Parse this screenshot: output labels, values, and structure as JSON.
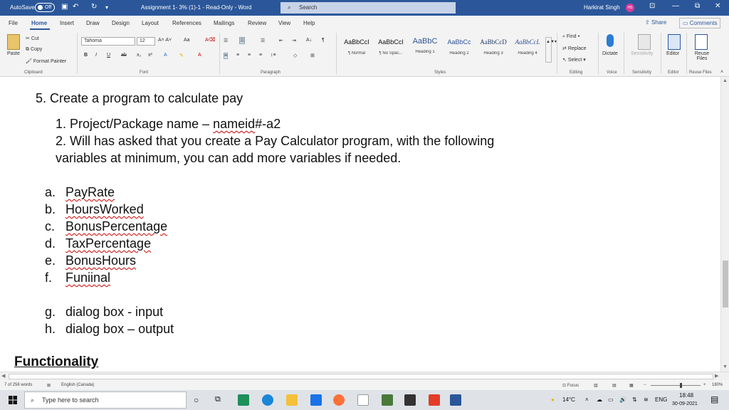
{
  "titlebar": {
    "autosave": "AutoSave",
    "toggle": "Off",
    "doc_title": "Assignment 1- 3% (1)-1 - Read-Only - Word",
    "search": "Search",
    "user": "Harkirat Singh",
    "avatar": "HS"
  },
  "tabs": [
    "File",
    "Home",
    "Insert",
    "Draw",
    "Design",
    "Layout",
    "References",
    "Mailings",
    "Review",
    "View",
    "Help"
  ],
  "share": "Share",
  "comments": "Comments",
  "ribbon": {
    "clipboard": {
      "paste": "Paste",
      "cut": "Cut",
      "copy": "Copy",
      "format_painter": "Format Painter",
      "label": "Clipboard"
    },
    "font": {
      "name": "Tahoma",
      "size": "12",
      "label": "Font"
    },
    "paragraph": {
      "label": "Paragraph"
    },
    "styles": {
      "label": "Styles",
      "items": [
        {
          "sample": "AaBbCcI",
          "name": "¶ Normal"
        },
        {
          "sample": "AaBbCcI",
          "name": "¶ No Spac..."
        },
        {
          "sample": "AaBbC",
          "name": "Heading 1"
        },
        {
          "sample": "AaBbCc",
          "name": "Heading 2"
        },
        {
          "sample": "AaBbCcD",
          "name": "Heading 3"
        },
        {
          "sample": "AaBbCcL",
          "name": "Heading 4"
        }
      ]
    },
    "editing": {
      "find": "Find",
      "replace": "Replace",
      "select": "Select",
      "label": "Editing"
    },
    "voice": {
      "dictate": "Dictate",
      "label": "Voice"
    },
    "sensitivity": {
      "btn": "Sensitivity",
      "label": "Sensitivity"
    },
    "editor": {
      "btn": "Editor",
      "label": "Editor"
    },
    "reuse": {
      "btn": "Reuse Files",
      "label": "Reuse Files"
    }
  },
  "document": {
    "item5": "5.  Create a program to calculate pay",
    "sub1_prefix": "1.  Project/Package name – ",
    "sub1_name": "nameid",
    "sub1_suffix": "#-a2",
    "sub2_line1": "2.  Will has asked that you create a Pay Calculator program, with the following",
    "sub2_line2": "variables at minimum, you can add more variables if needed.",
    "vars": [
      {
        "marker": "a.",
        "name": "PayRate"
      },
      {
        "marker": "b.",
        "name": "HoursWorked"
      },
      {
        "marker": "c.",
        "name": "BonusPercentage"
      },
      {
        "marker": "d.",
        "name": "TaxPercentage"
      },
      {
        "marker": "e.",
        "name": "BonusHours"
      },
      {
        "marker": "f.",
        "name": "Funiinal"
      }
    ],
    "dialogs": [
      {
        "marker": "g.",
        "text": "dialog box - input"
      },
      {
        "marker": "h.",
        "text": "dialog box – output"
      }
    ],
    "functionality": "Functionality"
  },
  "status": {
    "words": "7 of 256 words",
    "language": "English (Canada)",
    "focus": "Focus",
    "zoom": "180%"
  },
  "taskbar": {
    "search": "Type here to search",
    "temp": "14°C",
    "lang": "ENG",
    "time": "18:48",
    "date": "30-09-2021"
  },
  "colors": {
    "word_blue": "#2b579a",
    "taskbar": "#dfe3e8"
  }
}
